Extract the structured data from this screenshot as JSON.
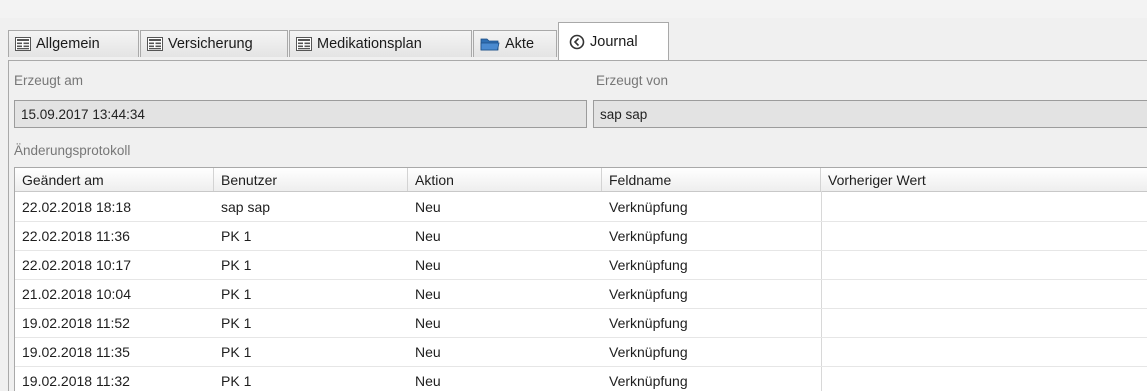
{
  "tabs": [
    {
      "label": "Allgemein",
      "icon": "form-icon"
    },
    {
      "label": "Versicherung",
      "icon": "form-icon"
    },
    {
      "label": "Medikationsplan",
      "icon": "form-icon"
    },
    {
      "label": "Akte",
      "icon": "folder-icon"
    },
    {
      "label": "Journal",
      "icon": "history-icon",
      "active": true
    }
  ],
  "meta": {
    "created_at_label": "Erzeugt am",
    "created_at_value": "15.09.2017 13:44:34",
    "created_by_label": "Erzeugt von",
    "created_by_value": "sap sap"
  },
  "changelog": {
    "label": "Änderungsprotokoll",
    "columns": [
      "Geändert am",
      "Benutzer",
      "Aktion",
      "Feldname",
      "Vorheriger Wert"
    ],
    "rows": [
      [
        "22.02.2018 18:18",
        "sap sap",
        "Neu",
        "Verknüpfung",
        ""
      ],
      [
        "22.02.2018 11:36",
        "PK 1",
        "Neu",
        "Verknüpfung",
        ""
      ],
      [
        "22.02.2018 10:17",
        "PK 1",
        "Neu",
        "Verknüpfung",
        ""
      ],
      [
        "21.02.2018 10:04",
        "PK 1",
        "Neu",
        "Verknüpfung",
        ""
      ],
      [
        "19.02.2018 11:52",
        "PK 1",
        "Neu",
        "Verknüpfung",
        ""
      ],
      [
        "19.02.2018 11:35",
        "PK 1",
        "Neu",
        "Verknüpfung",
        ""
      ],
      [
        "19.02.2018 11:32",
        "PK 1",
        "Neu",
        "Verknüpfung",
        ""
      ]
    ]
  },
  "colors": {
    "panel_bg": "#f0f0f0",
    "field_bg": "#e3e3e3",
    "grid_bg": "#ffffff",
    "folder_icon": "#2b6cb0"
  }
}
